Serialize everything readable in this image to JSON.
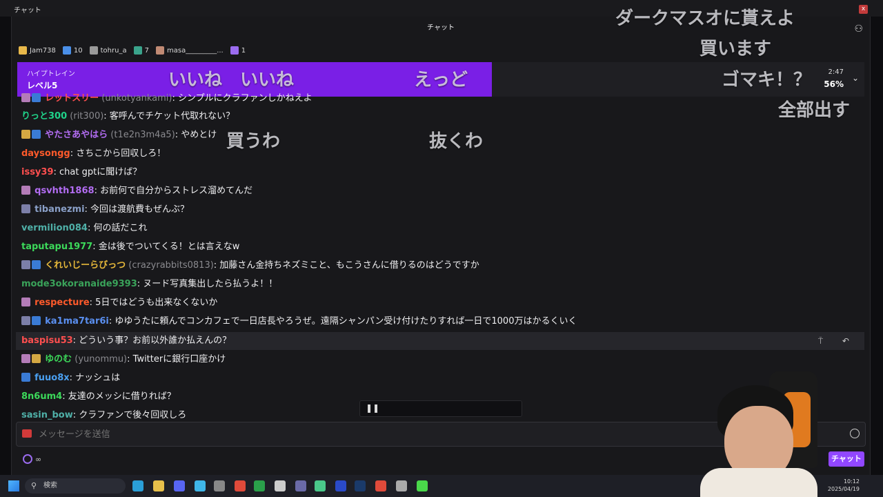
{
  "window": {
    "title": "チャット",
    "close_label": "x"
  },
  "chat": {
    "header_title": "チャット"
  },
  "leaderboard": [
    {
      "name": "Jam738",
      "icon": "gift-icon"
    },
    {
      "name": "10",
      "icon": "gift-icon"
    },
    {
      "name": "tohru_a",
      "icon": "gift-icon"
    },
    {
      "name": "7",
      "icon": "gift-icon"
    },
    {
      "name": "masa_________...",
      "icon": "gift-icon"
    },
    {
      "name": "1",
      "icon": "gift-icon"
    }
  ],
  "hype_train": {
    "label": "ハイプトレイン",
    "level": "レベル5",
    "time": "2:47",
    "percent": "56%",
    "progress": 0.56,
    "accent": "#7a1fe6"
  },
  "overlay": [
    "ダークマスオに貰えよ",
    "買います",
    "ゴマキ！？",
    "全部出す",
    "いいね　いいね",
    "えっど",
    "買うわ",
    "抜くわ"
  ],
  "messages": [
    {
      "user": "レットスリー",
      "login": "(unkotyankami)",
      "text": ": シンプルにクラファンしかねえよ",
      "color": "#ff4f4f",
      "badges": [
        "av",
        "sub"
      ]
    },
    {
      "user": "りっと300",
      "login": "(rit300)",
      "text": ": 客呼んでチケット代取れない？",
      "color": "#1fd38a",
      "badges": []
    },
    {
      "user": "やたさあやはら",
      "login": "(t1e2n3m4a5)",
      "text": ": やめとけ",
      "color": "#b26cf2",
      "badges": [
        "star",
        "sub"
      ]
    },
    {
      "user": "daysongg",
      "login": "",
      "text": ": さちこから回収しろ！",
      "color": "#ff5a2b",
      "badges": []
    },
    {
      "user": "issy39",
      "login": "",
      "text": ": chat gptに聞けば？",
      "color": "#ff4f4f",
      "badges": []
    },
    {
      "user": "qsvhth1868",
      "login": "",
      "text": ": お前何で自分からストレス溜めてんだ",
      "color": "#b26cf2",
      "badges": [
        "av"
      ]
    },
    {
      "user": "tibanezmi",
      "login": "",
      "text": ": 今回は渡航費もぜんぶ？",
      "color": "#8aa0c8",
      "badges": [
        "av2"
      ]
    },
    {
      "user": "vermilion084",
      "login": "",
      "text": ": 何の話だこれ",
      "color": "#4fb0a8",
      "badges": []
    },
    {
      "user": "taputapu1977",
      "login": "",
      "text": ": 金は後でついてくる！とは言えなw",
      "color": "#3cd95a",
      "badges": []
    },
    {
      "user": "くれいじーらびっつ",
      "login": "(crazyrabbits0813)",
      "text": ": 加藤さん金持ちネズミこと、もこうさんに借りるのはどうですか",
      "color": "#e6b83a",
      "badges": [
        "av2",
        "sub"
      ]
    },
    {
      "user": "mode3okoranaide9393",
      "login": "",
      "text": ": ヌード写真集出したら払うよ！！",
      "color": "#3aa35a",
      "badges": []
    },
    {
      "user": "respecture",
      "login": "",
      "text": ": 5日ではどうも出来なくないか",
      "color": "#ff5a2b",
      "badges": [
        "av"
      ]
    },
    {
      "user": "ka1ma7tar6i",
      "login": "",
      "text": ": ゆゆうたに頼んでコンカフェで一日店長やろうぜ。遠隔シャンパン受け付けたりすれば一日で1000万はかるくいく",
      "color": "#5a8ff0",
      "badges": [
        "av2",
        "sub"
      ]
    },
    {
      "user": "baspisu53",
      "login": "",
      "text": ": どういう事？お前以外誰か払えんの？",
      "color": "#ff4f4f",
      "badges": [],
      "highlight": true
    },
    {
      "user": "ゆのむ",
      "login": "(yunommu)",
      "text": ": Twitterに銀行口座かけ",
      "color": "#3cd95a",
      "badges": [
        "av",
        "star"
      ]
    },
    {
      "user": "fuuo8x",
      "login": "",
      "text": ": ナッシュは",
      "color": "#4a9ff0",
      "badges": [
        "sub"
      ]
    },
    {
      "user": "8n6um4",
      "login": "",
      "text": ": 友達のメッシに借りれば？",
      "color": "#3cd95a",
      "badges": []
    },
    {
      "user": "sasin_bow",
      "login": "",
      "text": ": クラファンで後々回収しろ",
      "color": "#4fb0a8",
      "badges": []
    }
  ],
  "msg_actions": "⍑ ↶",
  "pause_icon": "❚❚",
  "input": {
    "placeholder": "メッセージを送信"
  },
  "points": {
    "value": "∞"
  },
  "chat_button": "チャット",
  "taskbar": {
    "search": "検索",
    "time": "10:12",
    "date": "2025/04/19"
  }
}
